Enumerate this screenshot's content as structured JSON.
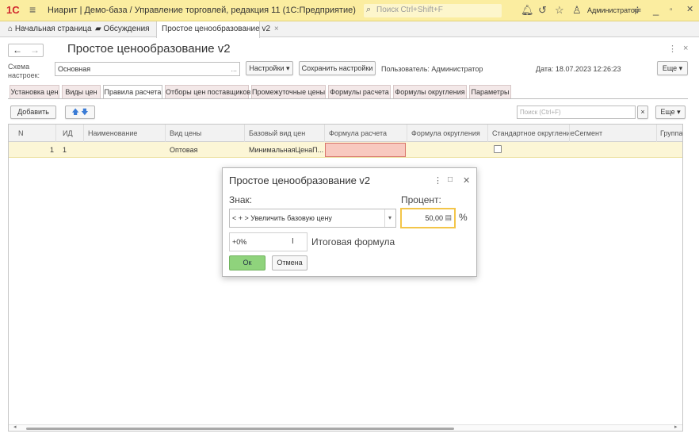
{
  "window": {
    "logo": "1С",
    "title": "Ниарит | Демо-база / Управление торговлей, редакция 11  (1С:Предприятие)",
    "search_placeholder": "Поиск Ctrl+Shift+F",
    "user": "Администратор"
  },
  "tabs": [
    {
      "label": "Начальная страница",
      "icon": "home-icon"
    },
    {
      "label": "Обсуждения",
      "icon": "chat-icon"
    },
    {
      "label": "Простое ценообразование v2",
      "icon": ""
    }
  ],
  "form": {
    "title": "Простое ценообразование v2",
    "schema_label": "Схема настроек:",
    "schema_value": "Основная",
    "settings_button": "Настройки",
    "save_settings_button": "Сохранить настройки",
    "user_text": "Пользователь: Администратор",
    "date_text": "Дата: 18.07.2023 12:26:23",
    "more_button": "Еще"
  },
  "form_tabs": [
    "Установка цен",
    "Виды цен",
    "Правила расчета",
    "Отборы цен поставщиков",
    "Промежуточные цены",
    "Формулы расчета",
    "Формулы округления",
    "Параметры"
  ],
  "toolbar": {
    "add_button": "Добавить",
    "search_placeholder": "Поиск (Ctrl+F)",
    "more_button": "Еще"
  },
  "table": {
    "columns": [
      "N",
      "ИД",
      "Наименование",
      "Вид цены",
      "Базовый вид цен",
      "Формула расчета",
      "Формула округления",
      "Стандартное округление",
      "Сегмент",
      "Группа"
    ],
    "rows": [
      {
        "n": "1",
        "id": "1",
        "name": "",
        "price_type": "Оптовая",
        "base_price": "МинимальнаяЦенаП...",
        "formula": "",
        "rounding": "",
        "standard_rounding": false,
        "segment": "",
        "group": ""
      }
    ]
  },
  "dialog": {
    "title": "Простое ценообразование v2",
    "sign_label": "Знак:",
    "sign_value": "< + > Увеличить базовую цену",
    "percent_label": "Процент:",
    "percent_value": "50,00",
    "percent_sign": "%",
    "formula_value": "+0%",
    "formula_label": "Итоговая формула",
    "ok_button": "Ок",
    "cancel_button": "Отмена"
  },
  "colors": {
    "titlebar": "#fbeda0",
    "selected_row": "#fcf6d6",
    "error_cell": "#f8c9bf",
    "ok_button": "#8fd37c",
    "focus_border": "#f3c549"
  }
}
